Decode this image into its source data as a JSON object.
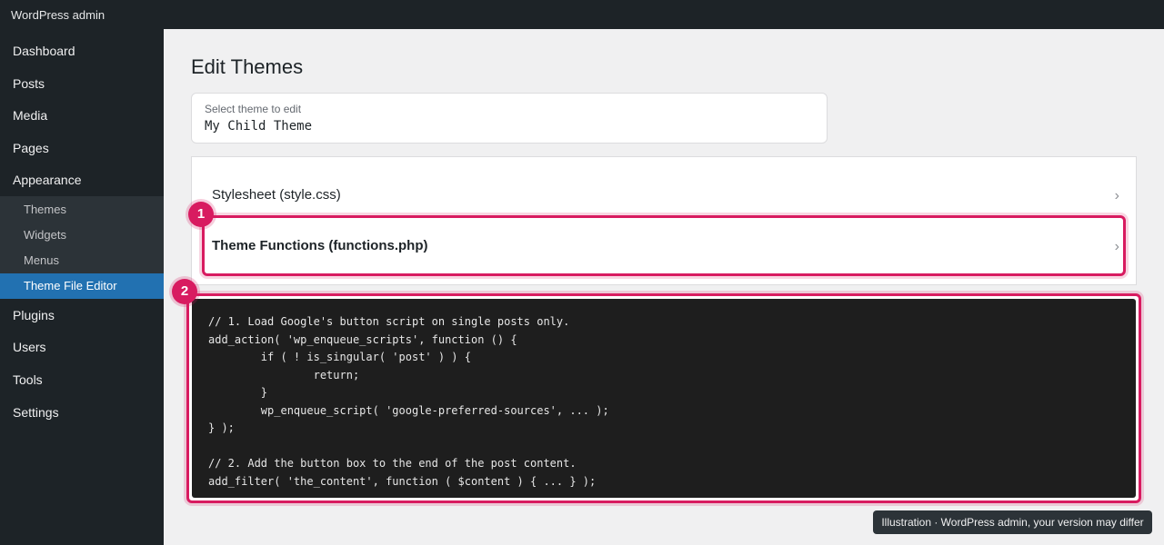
{
  "topbar": {
    "title": "WordPress admin"
  },
  "sidebar": {
    "items": [
      {
        "label": "Dashboard"
      },
      {
        "label": "Posts"
      },
      {
        "label": "Media"
      },
      {
        "label": "Pages"
      },
      {
        "label": "Appearance"
      }
    ],
    "submenu": [
      {
        "label": "Themes"
      },
      {
        "label": "Widgets"
      },
      {
        "label": "Menus"
      },
      {
        "label": "Theme File Editor",
        "active": true
      }
    ],
    "items_after": [
      {
        "label": "Plugins"
      },
      {
        "label": "Users"
      },
      {
        "label": "Tools"
      },
      {
        "label": "Settings"
      }
    ]
  },
  "main": {
    "title": "Edit Themes",
    "theme_select": {
      "label": "Select theme to edit",
      "value": "My Child Theme"
    },
    "files": [
      {
        "label": "Stylesheet (style.css)"
      },
      {
        "label": "Theme Functions (functions.php)"
      }
    ],
    "code_lines": [
      "// 1. Load Google's button script on single posts only.",
      "add_action( 'wp_enqueue_scripts', function () {",
      "        if ( ! is_singular( 'post' ) ) {",
      "                return;",
      "        }",
      "        wp_enqueue_script( 'google-preferred-sources', ... );",
      "} );",
      "",
      "// 2. Add the button box to the end of the post content.",
      "add_filter( 'the_content', function ( $content ) { ... } );"
    ]
  },
  "annotations": {
    "badge1": "1",
    "badge2": "2"
  },
  "tooltip": "Illustration · WordPress admin, your version may differ",
  "icons": {
    "chevron": "›"
  },
  "colors": {
    "accent": "#2271b1",
    "highlight": "#d81b60",
    "sidebar": "#1d2327"
  }
}
